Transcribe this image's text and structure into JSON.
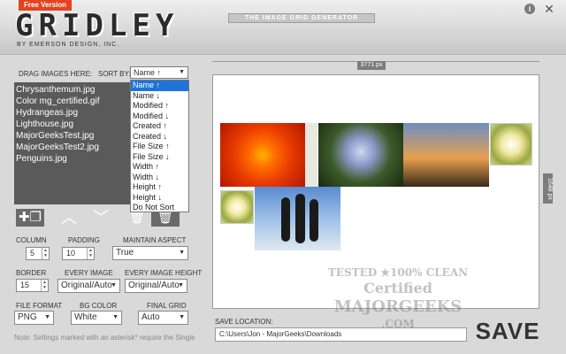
{
  "header": {
    "badge": "Free Version",
    "logo": "GRIDLEY",
    "logo_sub": "BY EMERSON DESIGN, INC.",
    "tagline": "THE IMAGE GRID GENERATOR"
  },
  "left": {
    "drag_label": "DRAG IMAGES HERE:",
    "sort_label": "SORT BY:",
    "sort_value": "Name ↑",
    "sort_options": [
      "Name ↑",
      "Name ↓",
      "Modified ↑",
      "Modified ↓",
      "Created ↑",
      "Created ↓",
      "File Size ↑",
      "File Size ↓",
      "Width ↑",
      "Width ↓",
      "Height ↑",
      "Height ↓",
      "Do Not Sort"
    ],
    "files": [
      "Chrysanthemum.jpg",
      "Color mg_certified.gif",
      "Hydrangeas.jpg",
      "Lighthouse.jpg",
      "MajorGeeksTest.jpg",
      "MajorGeeksTest2.jpg",
      "Penguins.jpg"
    ],
    "column_label": "COLUMN",
    "column_value": "5",
    "padding_label": "PADDING",
    "padding_value": "10",
    "aspect_label": "MAINTAIN ASPECT",
    "aspect_value": "True",
    "border_label": "BORDER",
    "border_value": "15",
    "every_image_label": "EVERY IMAGE",
    "every_image_value": "Original/Auto",
    "every_height_label": "EVERY IMAGE HEIGHT",
    "every_height_value": "Original/Auto",
    "format_label": "FILE FORMAT",
    "format_value": "PNG",
    "bg_label": "BG COLOR",
    "bg_value": "White",
    "grid_label": "FINAL GRID",
    "grid_value": "Auto",
    "note": "Note: Settings marked with an asterisk* require the Single"
  },
  "preview": {
    "width_label": "3771 px",
    "height_label": "1648 px"
  },
  "save": {
    "location_label": "SAVE LOCATION:",
    "path": "C:\\Users\\Jon - MajorGeeks\\Downloads",
    "button": "SAVE"
  },
  "watermark": {
    "line1": "TESTED ★100% CLEAN",
    "line2": "Certified",
    "line3": "MAJORGEEKS",
    "line4": ".COM"
  },
  "colors": {
    "accent": "#e4431f",
    "selected": "#1e73d8",
    "list_bg": "#5a5a5a"
  }
}
